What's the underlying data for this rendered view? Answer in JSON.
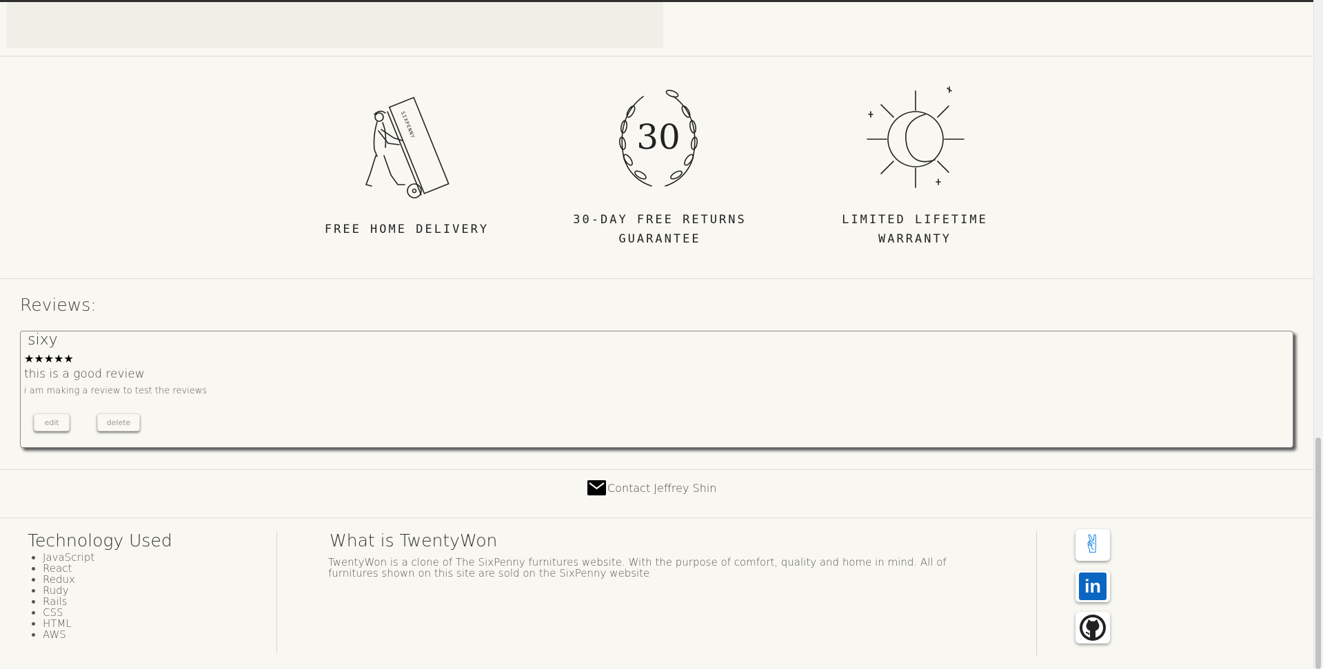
{
  "features": [
    {
      "label_line1": "FREE HOME DELIVERY",
      "label_line2": "",
      "dolly_text": "SIXPENNY",
      "icon": "delivery-dolly-icon"
    },
    {
      "label_line1": "30-DAY FREE RETURNS",
      "label_line2": "GUARANTEE",
      "badge_number": "30",
      "icon": "laurel-wreath-icon"
    },
    {
      "label_line1": "LIMITED LIFETIME",
      "label_line2": "WARRANTY",
      "icon": "sun-moon-icon"
    }
  ],
  "reviews": {
    "heading": "Reviews:",
    "items": [
      {
        "author": "sixy",
        "stars": "★★★★★",
        "rating": 5,
        "title": "this is a good review",
        "body": "i am making a review to test the reviews",
        "edit_label": "edit",
        "delete_label": "delete"
      }
    ]
  },
  "contact": {
    "label": "Contact Jeffrey Shin",
    "icon": "mail-icon"
  },
  "footer": {
    "tech_title": "Technology Used",
    "tech_items": [
      "JavaScript",
      "React",
      "Redux",
      "Rudy",
      "Rails",
      "CSS",
      "HTML",
      "AWS"
    ],
    "about_title": "What is TwentyWon",
    "about_text": "TwentyWon is a clone of The SixPenny furnitures website. With the purpose of comfort, quality and home in mind. All of furnitures shown on this site are sold on the SixPenny website",
    "social": [
      {
        "name": "angellist",
        "icon": "angellist-icon",
        "glyph": "✌"
      },
      {
        "name": "linkedin",
        "icon": "linkedin-icon",
        "glyph": "in"
      },
      {
        "name": "github",
        "icon": "github-icon"
      }
    ]
  },
  "colors": {
    "background": "#f8f7f1",
    "linkedin": "#0a66c2",
    "angellist": "#1e88e5"
  }
}
